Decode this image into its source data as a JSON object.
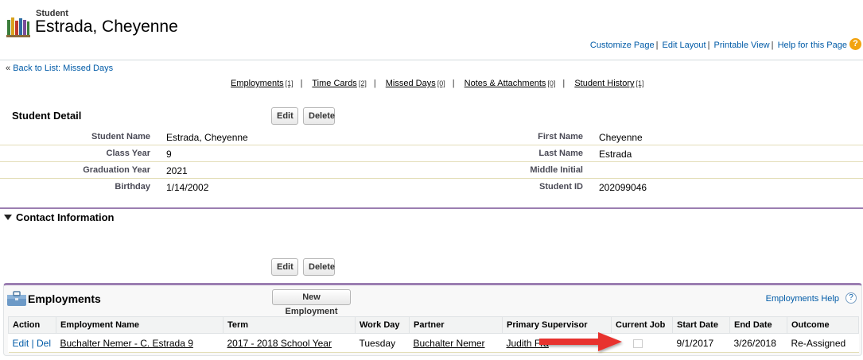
{
  "header": {
    "object_type": "Student",
    "record_title": "Estrada, Cheyenne",
    "links": [
      "Customize Page",
      "Edit Layout",
      "Printable View",
      "Help for this Page"
    ],
    "help_icon": "?"
  },
  "back_link": {
    "chevron": "«",
    "label": "Back to List: Missed Days"
  },
  "related_links": [
    {
      "label": "Employments",
      "count": "[1]"
    },
    {
      "label": "Time Cards",
      "count": "[2]"
    },
    {
      "label": "Missed Days",
      "count": "[0]"
    },
    {
      "label": "Notes & Attachments",
      "count": "[0]"
    },
    {
      "label": "Student History",
      "count": "[1]"
    }
  ],
  "detail": {
    "title": "Student Detail",
    "edit_label": "Edit",
    "delete_label": "Delete",
    "fields": [
      {
        "l1": "Student Name",
        "v1": "Estrada, Cheyenne",
        "l2": "First Name",
        "v2": "Cheyenne"
      },
      {
        "l1": "Class Year",
        "v1": "9",
        "l2": "Last Name",
        "v2": "Estrada"
      },
      {
        "l1": "Graduation Year",
        "v1": "2021",
        "l2": "Middle Initial",
        "v2": ""
      },
      {
        "l1": "Birthday",
        "v1": "1/14/2002",
        "l2": "Student ID",
        "v2": "202099046"
      }
    ]
  },
  "contact": {
    "title": "Contact Information"
  },
  "bottom_buttons": {
    "edit_label": "Edit",
    "delete_label": "Delete"
  },
  "employments": {
    "title": "Employments",
    "new_button": "New Employment",
    "help_link": "Employments Help",
    "help_icon": "?",
    "columns": [
      "Action",
      "Employment Name",
      "Term",
      "Work Day",
      "Partner",
      "Primary Supervisor",
      "Current Job",
      "Start Date",
      "End Date",
      "Outcome"
    ],
    "rows": [
      {
        "edit": "Edit",
        "del": "Del",
        "name": "Buchalter Nemer - C. Estrada 9",
        "term": "2017 - 2018 School Year",
        "work_day": "Tuesday",
        "partner": "Buchalter Nemer",
        "supervisor": "Judith Fra",
        "current_job": false,
        "start_date": "9/1/2017",
        "end_date": "3/26/2018",
        "outcome": "Re-Assigned"
      }
    ]
  },
  "colors": {
    "accent": "#9b7eb1",
    "link": "#015ba7",
    "arrow": "#e8322f"
  }
}
